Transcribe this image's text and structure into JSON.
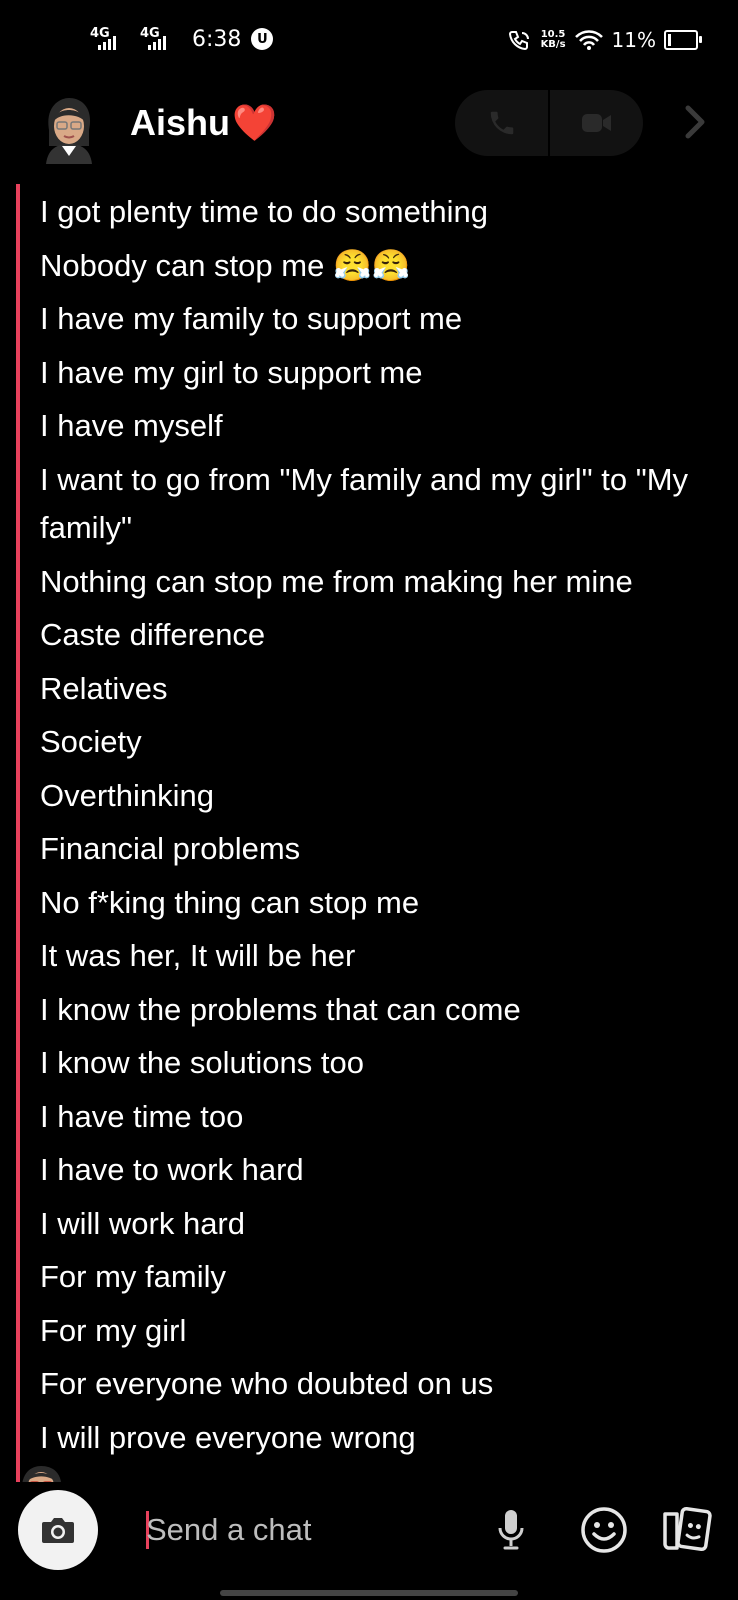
{
  "status_bar": {
    "network1": "4G",
    "network2": "4G",
    "time": "6:38",
    "speed_value": "10.5",
    "speed_unit": "KB/s",
    "battery": "11%"
  },
  "header": {
    "contact_name": "Aishu",
    "heart": "❤️"
  },
  "messages": [
    "I got plenty time to do something",
    "Nobody can stop me 😤😤",
    "I have my family to support me",
    "I have my girl to support me",
    "I have myself",
    "I want to go from \"My family and my girl\" to \"My family\"",
    "Nothing can stop me from making her mine",
    "Caste difference",
    "Relatives",
    "Society",
    "Overthinking",
    "Financial problems",
    "No f*king thing can stop me",
    "It was her, It will be her",
    "I know the problems that can come",
    "I know the solutions too",
    "I have time too",
    "I have to work hard",
    "I will work hard",
    "For my family",
    "For my girl",
    "For everyone who doubted on us",
    "I will prove everyone wrong"
  ],
  "input": {
    "placeholder": "Send a chat"
  },
  "colors": {
    "accent": "#e8415c",
    "background": "#000000",
    "call_pill": "#121212"
  }
}
